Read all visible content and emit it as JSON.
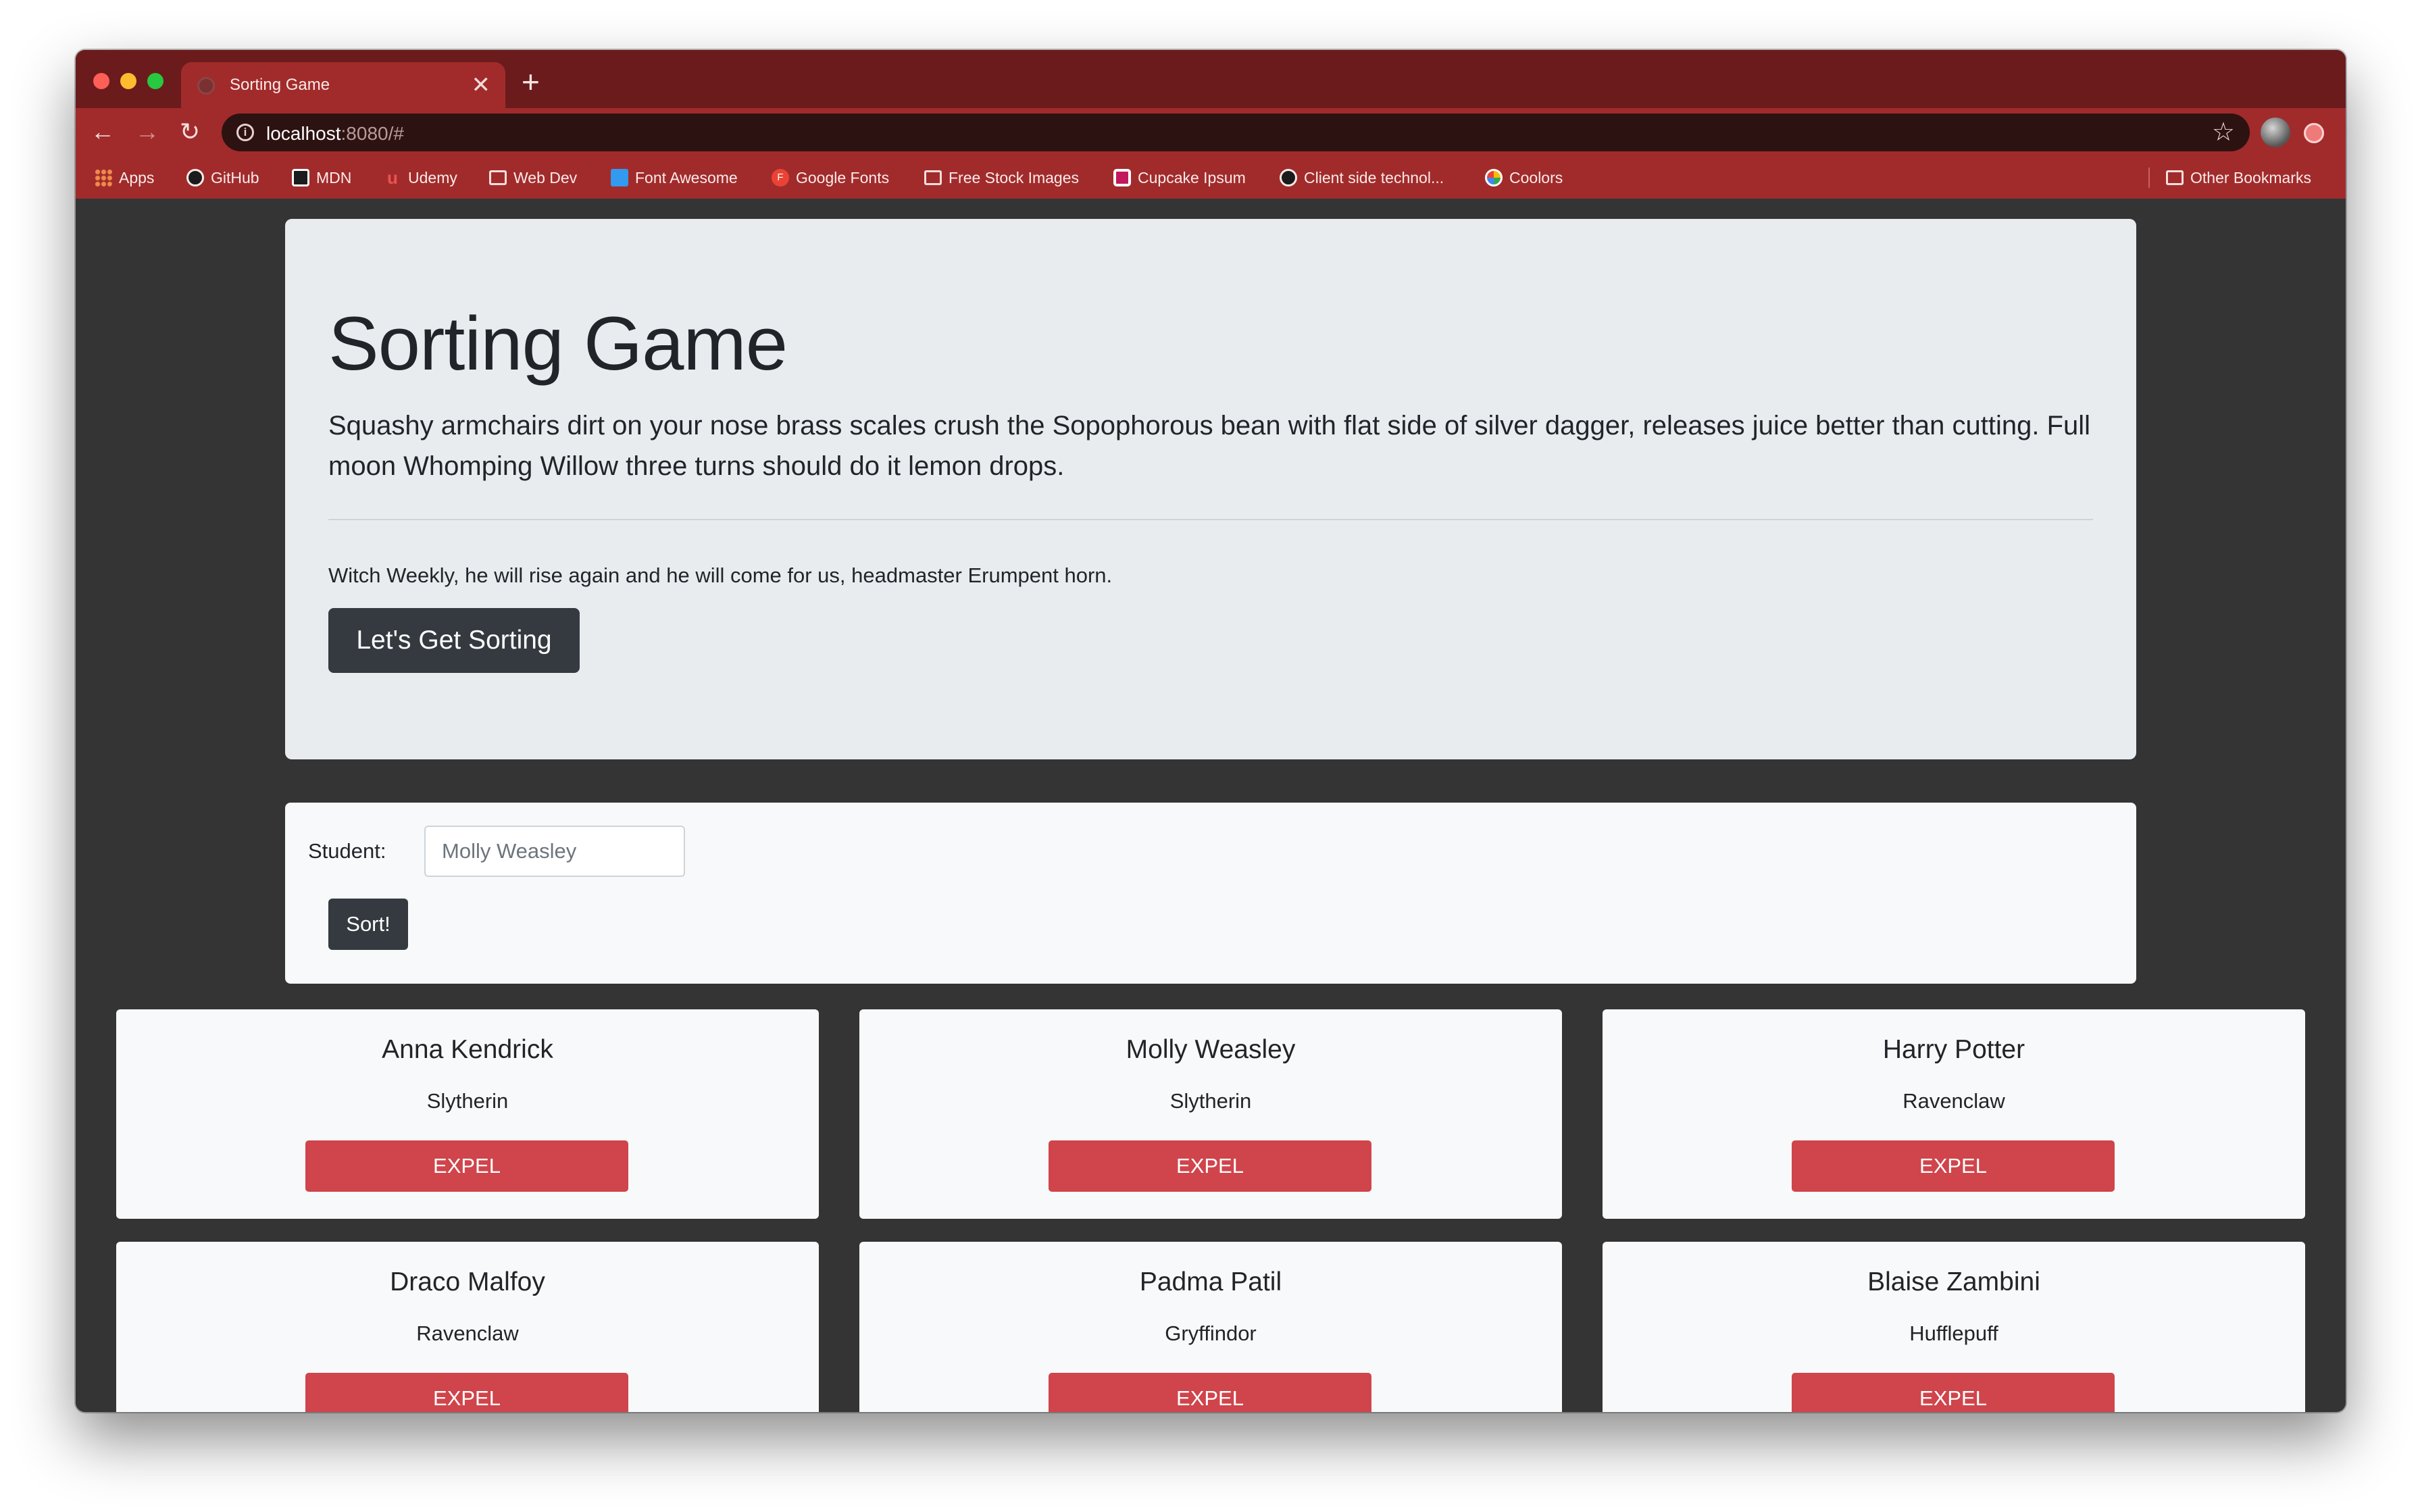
{
  "browser": {
    "tab_title": "Sorting Game",
    "tab_close": "✕",
    "new_tab": "+",
    "url_host": "localhost",
    "url_rest": ":8080/#",
    "bookmarks": [
      {
        "label": "Apps",
        "icon": "apps-grid-icon"
      },
      {
        "label": "GitHub",
        "icon": "github-icon"
      },
      {
        "label": "MDN",
        "icon": "mdn-icon"
      },
      {
        "label": "Udemy",
        "icon": "udemy-icon"
      },
      {
        "label": "Web Dev",
        "icon": "folder-icon"
      },
      {
        "label": "Font Awesome",
        "icon": "font-awesome-icon"
      },
      {
        "label": "Google Fonts",
        "icon": "google-fonts-icon"
      },
      {
        "label": "Free Stock Images",
        "icon": "folder-icon"
      },
      {
        "label": "Cupcake Ipsum",
        "icon": "cupcake-icon"
      },
      {
        "label": "Client side technol...",
        "icon": "github-icon"
      },
      {
        "label": "Coolors",
        "icon": "coolors-icon"
      },
      {
        "label": "Other Bookmarks",
        "icon": "folder-icon"
      }
    ]
  },
  "jumbotron": {
    "title": "Sorting Game",
    "lead": "Squashy armchairs dirt on your nose brass scales crush the Sopophorous bean with flat side of silver dagger, releases juice better than cutting. Full moon Whomping Willow three turns should do it lemon drops.",
    "text": "Witch Weekly, he will rise again and he will come for us, headmaster Erumpent horn.",
    "button_label": "Let's Get Sorting"
  },
  "form": {
    "label": "Student:",
    "input_value": "Molly Weasley",
    "button_label": "Sort!"
  },
  "students": [
    {
      "name": "Anna Kendrick",
      "house": "Slytherin",
      "button": "EXPEL"
    },
    {
      "name": "Molly Weasley",
      "house": "Slytherin",
      "button": "EXPEL"
    },
    {
      "name": "Harry Potter",
      "house": "Ravenclaw",
      "button": "EXPEL"
    },
    {
      "name": "Draco Malfoy",
      "house": "Ravenclaw",
      "button": "EXPEL"
    },
    {
      "name": "Padma Patil",
      "house": "Gryffindor",
      "button": "EXPEL"
    },
    {
      "name": "Blaise Zambini",
      "house": "Hufflepuff",
      "button": "EXPEL"
    }
  ],
  "colors": {
    "page_bg": "#343434",
    "browser_accent": "#a12b2b",
    "expel_red": "#d0444b",
    "dark_button": "#343a40"
  }
}
